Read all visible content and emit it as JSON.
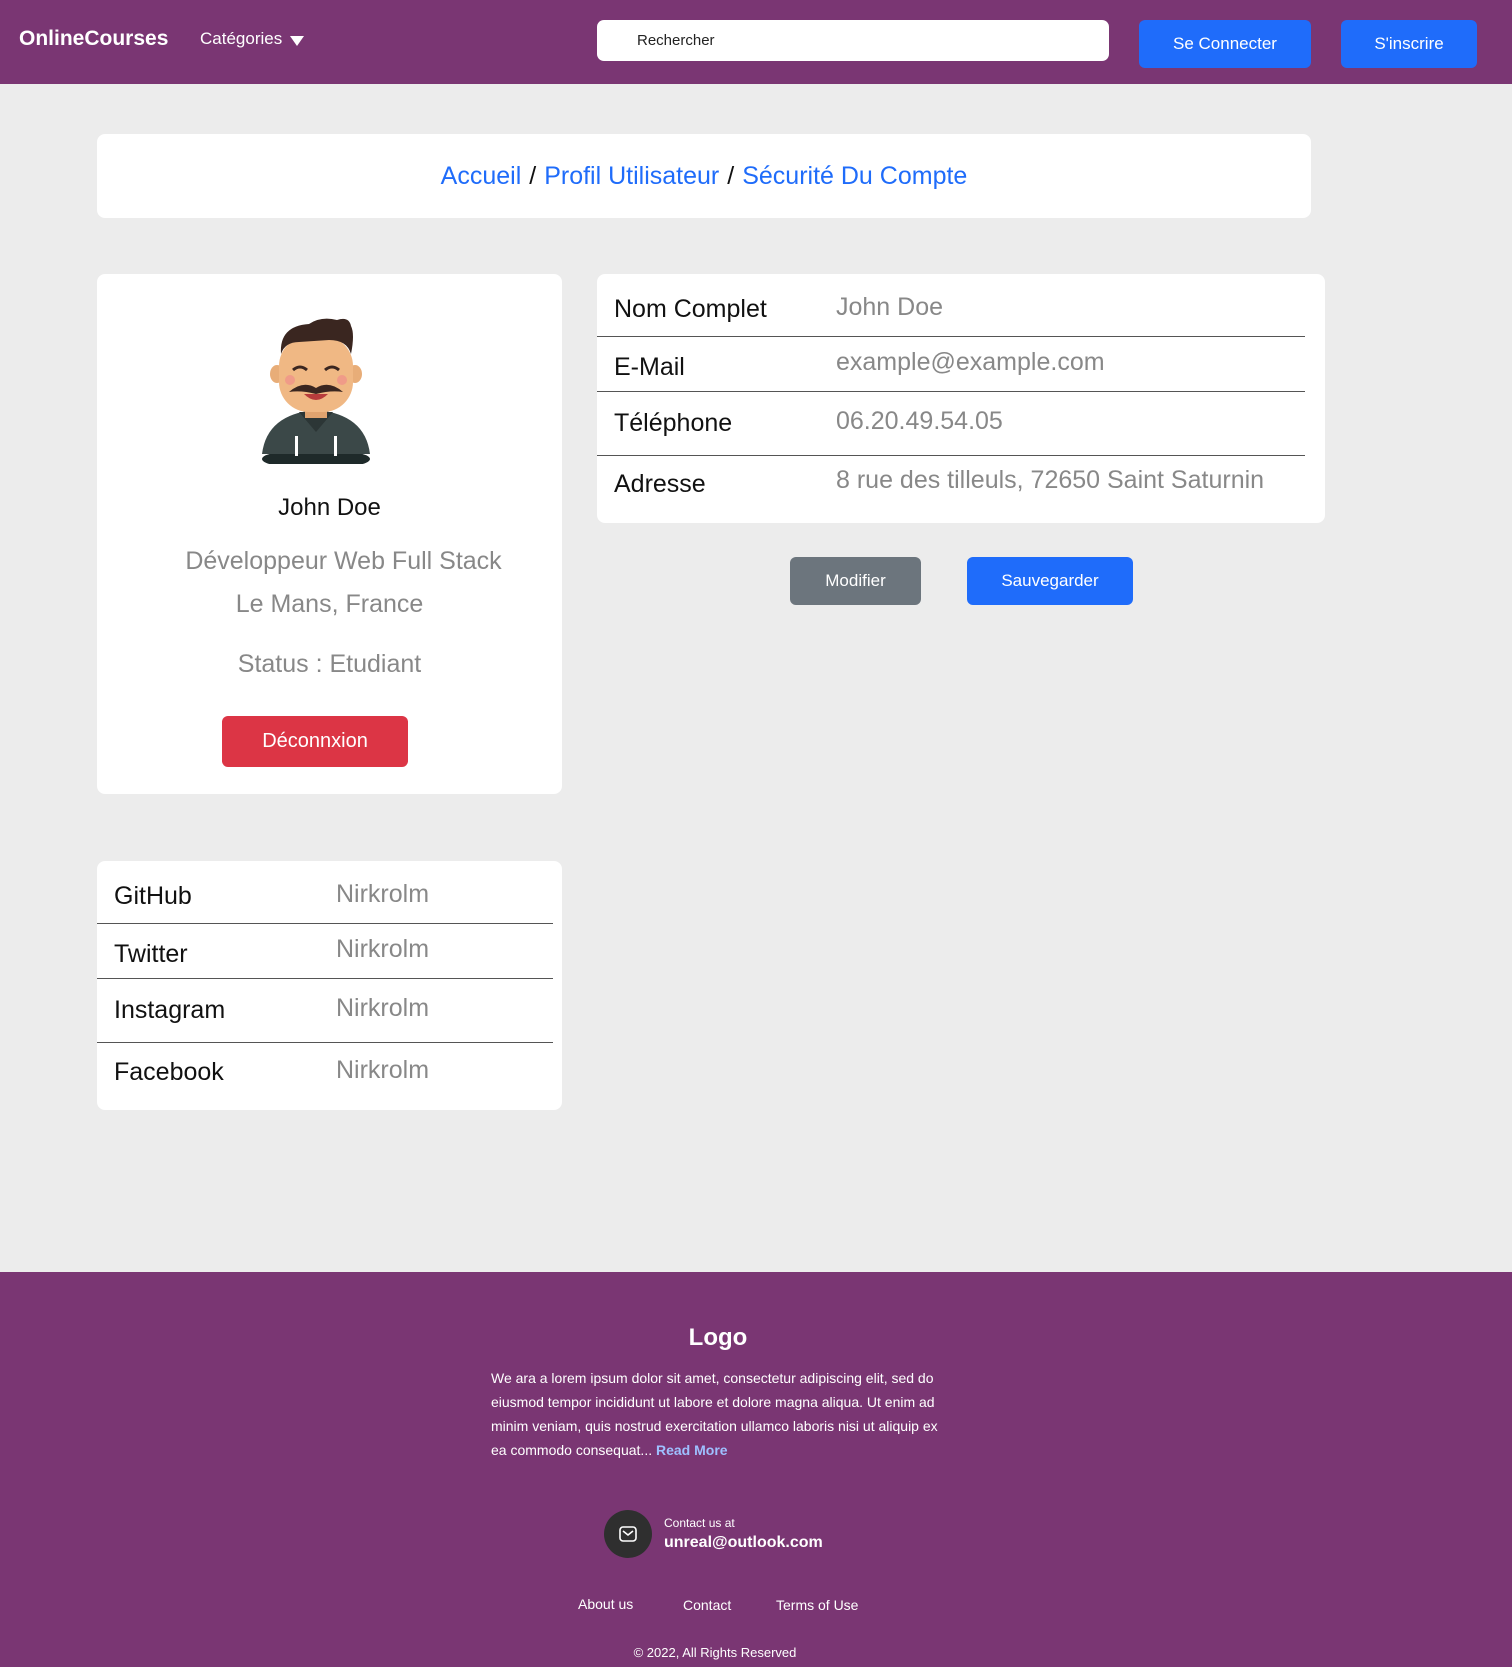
{
  "header": {
    "brand": "OnlineCourses",
    "categories_label": "Catégories",
    "search_placeholder": "Rechercher",
    "login_label": "Se Connecter",
    "signup_label": "S'inscrire"
  },
  "breadcrumb": {
    "items": [
      "Accueil",
      "Profil Utilisateur",
      "Sécurité Du Compte"
    ],
    "separator": "/"
  },
  "profile": {
    "name": "John Doe",
    "role": "Développeur Web Full Stack",
    "location": "Le Mans, France",
    "status": "Status : Etudiant",
    "logout_label": "Déconnxion"
  },
  "info": {
    "rows": [
      {
        "label": "Nom Complet",
        "value": "John Doe"
      },
      {
        "label": "E-Mail",
        "value": "example@example.com"
      },
      {
        "label": "Téléphone",
        "value": "06.20.49.54.05"
      },
      {
        "label": "Adresse",
        "value": "8 rue des tilleuls, 72650 Saint Saturnin"
      }
    ],
    "modify_label": "Modifier",
    "save_label": "Sauvegarder"
  },
  "social": {
    "rows": [
      {
        "label": "GitHub",
        "value": "Nirkrolm"
      },
      {
        "label": "Twitter",
        "value": "Nirkrolm"
      },
      {
        "label": "Instagram",
        "value": "Nirkrolm"
      },
      {
        "label": "Facebook",
        "value": "Nirkrolm"
      }
    ]
  },
  "footer": {
    "logo": "Logo",
    "description": "We ara a lorem ipsum dolor sit amet, consectetur adipiscing elit, sed do eiusmod tempor incididunt ut labore et dolore magna aliqua. Ut enim ad minim veniam, quis nostrud exercitation ullamco laboris nisi ut aliquip ex ea commodo consequat...",
    "read_more": "Read More",
    "contact_label": "Contact us at",
    "contact_email": "unreal@outlook.com",
    "links": [
      "About us",
      "Contact",
      "Terms of Use"
    ],
    "copyright": "© 2022, All Rights Reserved"
  },
  "colors": {
    "brand_purple": "#7a3673",
    "primary_blue": "#1f6cfa",
    "danger_red": "#dc3545",
    "secondary_gray": "#6c757d",
    "page_bg": "#ececec"
  }
}
